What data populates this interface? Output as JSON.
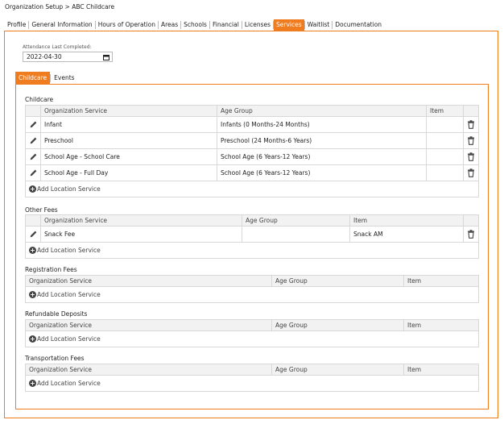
{
  "breadcrumb": "Organization Setup > ABC Childcare",
  "tabs": [
    "Profile",
    "General Information",
    "Hours of Operation",
    "Areas",
    "Schools",
    "Financial",
    "Licenses",
    "Services",
    "Waitlist",
    "Documentation"
  ],
  "active_tab": "Services",
  "attendance": {
    "label": "Attendance Last Completed:",
    "value": "2022-04-30"
  },
  "subtabs": [
    "Childcare",
    "Events"
  ],
  "add_label": "Add Location Service",
  "childcare": {
    "title": "Childcare",
    "headers": [
      "Organization Service",
      "Age Group",
      "Item"
    ],
    "rows": [
      [
        "Infant",
        "Infants (0 Months-24 Months)",
        ""
      ],
      [
        "Preschool",
        "Preschool (24 Months-6 Years)",
        ""
      ],
      [
        "School Age - School Care",
        "School Age (6 Years-12 Years)",
        ""
      ],
      [
        "School Age - Full Day",
        "School Age (6 Years-12 Years)",
        ""
      ]
    ]
  },
  "other_fees": {
    "title": "Other Fees",
    "headers": [
      "Organization Service",
      "Age Group",
      "Item"
    ],
    "rows": [
      [
        "Snack Fee",
        "",
        "Snack AM"
      ]
    ]
  },
  "registration_fees": {
    "title": "Registration Fees",
    "headers": [
      "Organization Service",
      "Age Group",
      "Item"
    ]
  },
  "refundable_deposits": {
    "title": "Refundable Deposits",
    "headers": [
      "Organization Service",
      "Age Group",
      "Item"
    ]
  },
  "transportation_fees": {
    "title": "Transportation Fees",
    "headers": [
      "Organization Service",
      "Age Group",
      "Item"
    ]
  },
  "colors": {
    "accent": "#f07c20"
  }
}
